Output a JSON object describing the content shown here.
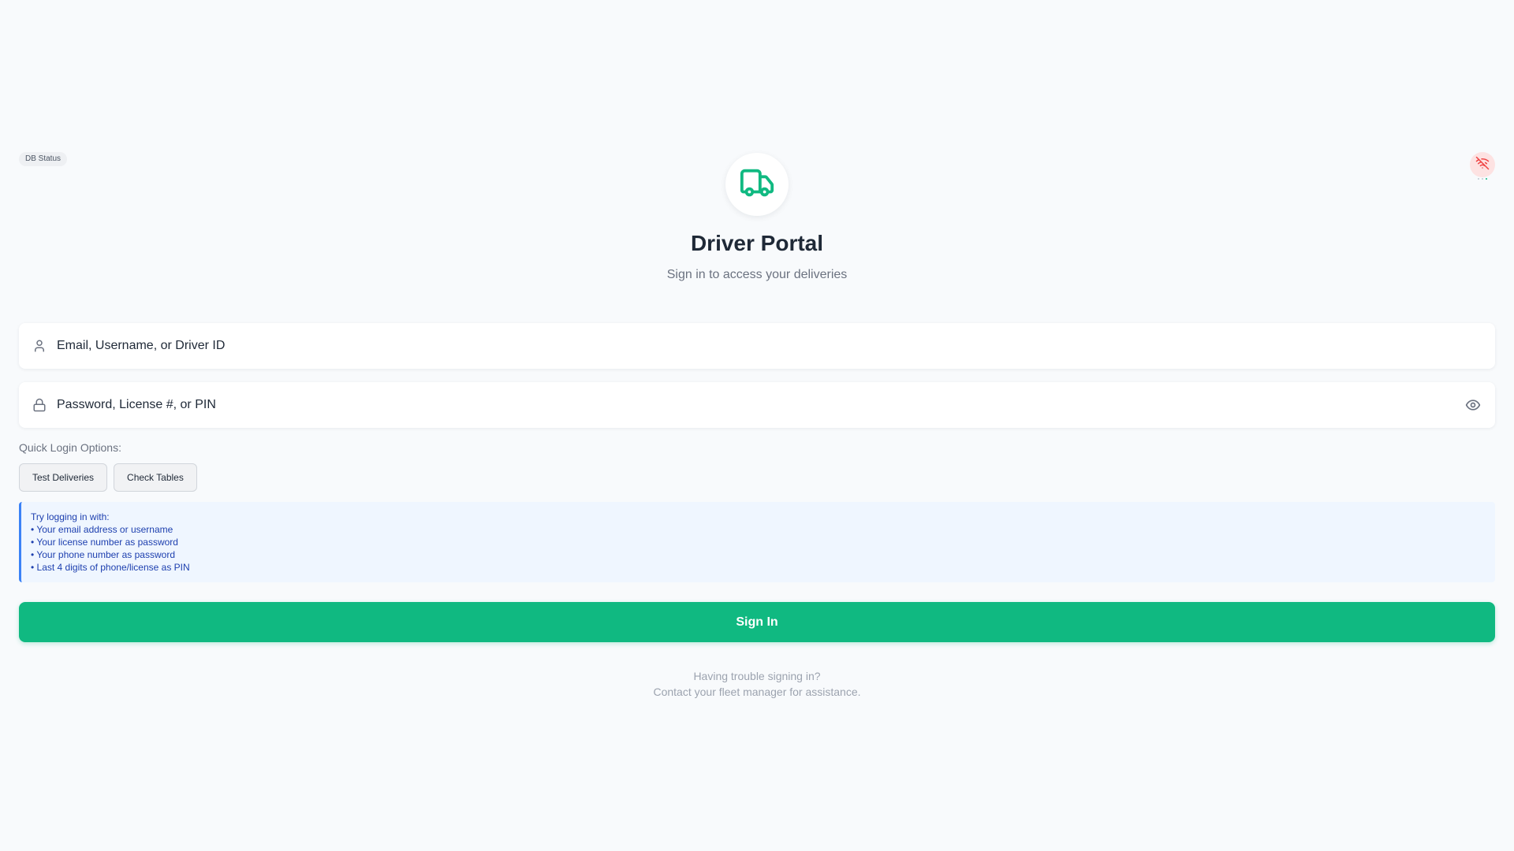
{
  "status": {
    "db_label": "DB Status",
    "connection_icon": "wifi-off-icon"
  },
  "header": {
    "logo_icon": "truck-icon",
    "title": "Driver Portal",
    "subtitle": "Sign in to access your deliveries"
  },
  "form": {
    "username": {
      "icon": "user-icon",
      "placeholder": "Email, Username, or Driver ID",
      "value": ""
    },
    "password": {
      "icon": "lock-icon",
      "placeholder": "Password, License #, or PIN",
      "value": "",
      "toggle_icon": "eye-icon"
    }
  },
  "quick_login": {
    "label": "Quick Login Options:",
    "buttons": [
      "Test Deliveries",
      "Check Tables"
    ]
  },
  "hint": {
    "title": "Try logging in with:",
    "items": [
      "• Your email address or username",
      "• Your license number as password",
      "• Your phone number as password",
      "• Last 4 digits of phone/license as PIN"
    ]
  },
  "submit_label": "Sign In",
  "help": {
    "line1": "Having trouble signing in?",
    "line2": "Contact your fleet manager for assistance."
  },
  "colors": {
    "brand": "#10b981",
    "background": "#f8fafc",
    "hint_bg": "#eff6ff",
    "hint_border": "#3b82f6",
    "hint_text": "#1e40af",
    "offline_bg": "#fde2e2",
    "offline_icon": "#ef4444"
  }
}
